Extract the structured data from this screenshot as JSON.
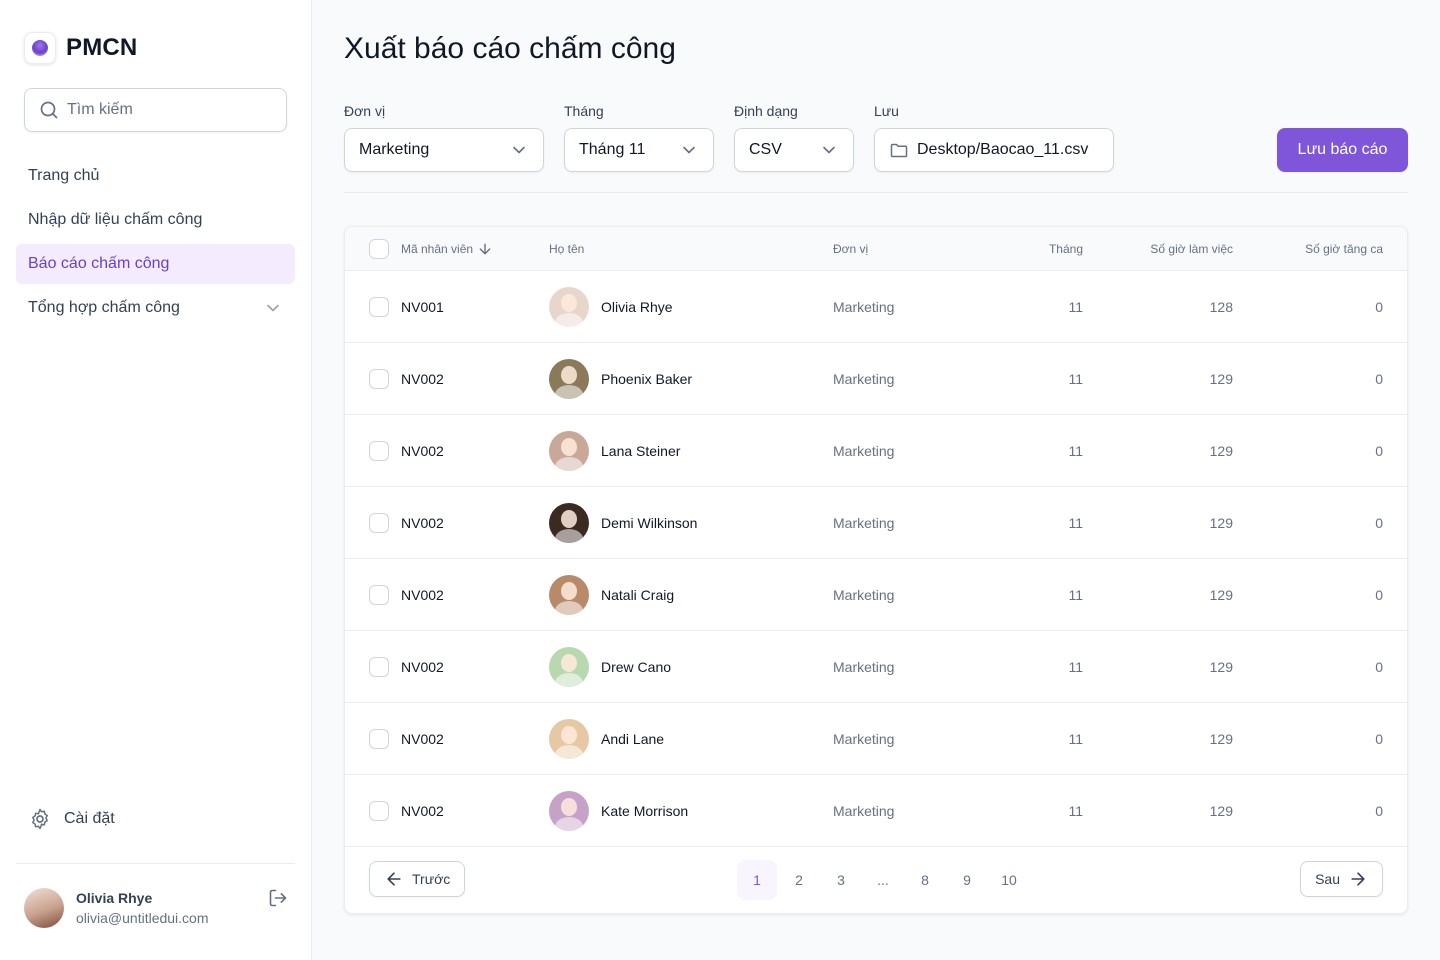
{
  "brand": {
    "name": "PMCN"
  },
  "sidebar": {
    "search_placeholder": "Tìm kiếm",
    "items": [
      {
        "label": "Trang chủ",
        "active": false
      },
      {
        "label": "Nhập dữ liệu chấm công",
        "active": false
      },
      {
        "label": "Báo cáo chấm công",
        "active": true
      },
      {
        "label": "Tổng hợp chấm công",
        "active": false,
        "expandable": true
      }
    ],
    "settings_label": "Cài đặt",
    "user": {
      "name": "Olivia Rhye",
      "email": "olivia@untitledui.com"
    }
  },
  "main": {
    "title": "Xuất báo cáo chấm công",
    "filters": {
      "department": {
        "label": "Đơn vị",
        "value": "Marketing"
      },
      "month": {
        "label": "Tháng",
        "value": "Tháng 11"
      },
      "format": {
        "label": "Định dạng",
        "value": "CSV"
      },
      "save_path": {
        "label": "Lưu",
        "value": "Desktop/Baocao_11.csv"
      }
    },
    "save_button": "Lưu báo cáo"
  },
  "table": {
    "headers": {
      "id": "Mã nhân viên",
      "name": "Họ tên",
      "dept": "Đơn vị",
      "month": "Tháng",
      "hours": "Số giờ làm việc",
      "overtime": "Số giờ tăng ca"
    },
    "rows": [
      {
        "id": "NV001",
        "name": "Olivia Rhye",
        "dept": "Marketing",
        "month": "11",
        "hours": "128",
        "overtime": "0",
        "avatar_color": "#e8d6cc"
      },
      {
        "id": "NV002",
        "name": "Phoenix Baker",
        "dept": "Marketing",
        "month": "11",
        "hours": "129",
        "overtime": "0",
        "avatar_color": "#8a7a5a"
      },
      {
        "id": "NV002",
        "name": "Lana Steiner",
        "dept": "Marketing",
        "month": "11",
        "hours": "129",
        "overtime": "0",
        "avatar_color": "#c9a89a"
      },
      {
        "id": "NV002",
        "name": "Demi Wilkinson",
        "dept": "Marketing",
        "month": "11",
        "hours": "129",
        "overtime": "0",
        "avatar_color": "#3a2a22"
      },
      {
        "id": "NV002",
        "name": "Natali Craig",
        "dept": "Marketing",
        "month": "11",
        "hours": "129",
        "overtime": "0",
        "avatar_color": "#b98a6a"
      },
      {
        "id": "NV002",
        "name": "Drew Cano",
        "dept": "Marketing",
        "month": "11",
        "hours": "129",
        "overtime": "0",
        "avatar_color": "#b8d8b0"
      },
      {
        "id": "NV002",
        "name": "Andi Lane",
        "dept": "Marketing",
        "month": "11",
        "hours": "129",
        "overtime": "0",
        "avatar_color": "#e6c9a4"
      },
      {
        "id": "NV002",
        "name": "Kate Morrison",
        "dept": "Marketing",
        "month": "11",
        "hours": "129",
        "overtime": "0",
        "avatar_color": "#c7a2c8"
      }
    ]
  },
  "pagination": {
    "prev_label": "Trước",
    "next_label": "Sau",
    "pages": [
      "1",
      "2",
      "3",
      "...",
      "8",
      "9",
      "10"
    ],
    "current": "1"
  },
  "colors": {
    "accent": "#7f56d9",
    "accent_light": "#f4ebff",
    "border": "#d0d5dd",
    "text_muted": "#667085"
  }
}
